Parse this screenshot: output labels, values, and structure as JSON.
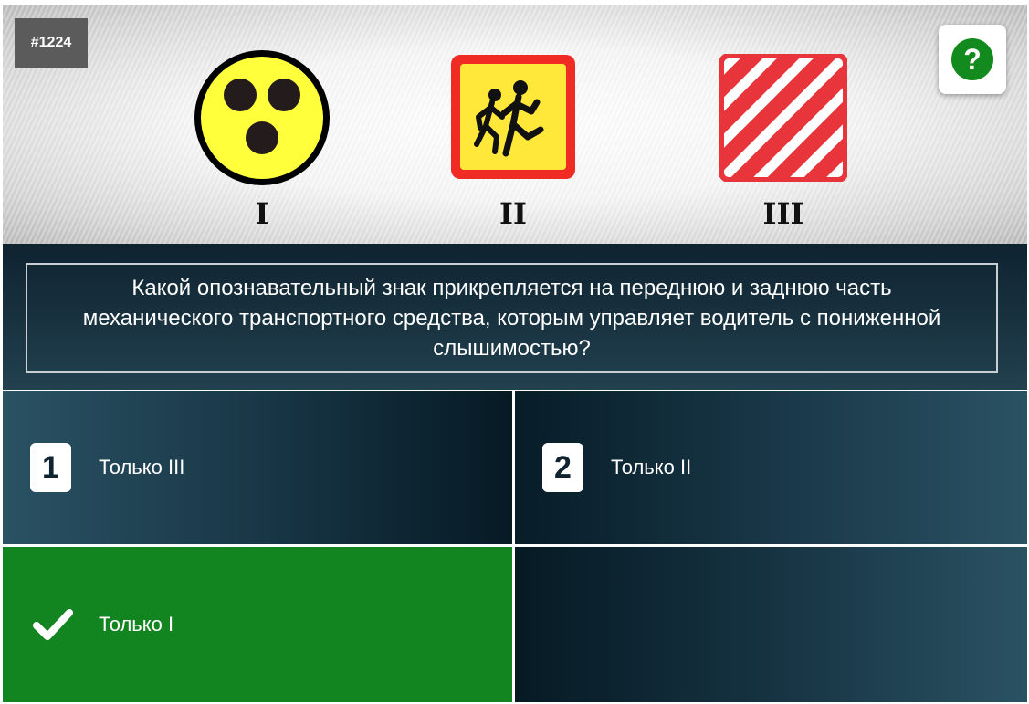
{
  "question": {
    "id": "#1224",
    "text": "Какой опознавательный знак прикрепляется на переднюю и заднюю часть механического транспортного средства, которым управляет водитель с пониженной слышимостью?"
  },
  "help": {
    "label": "?"
  },
  "signs": [
    {
      "label": "I",
      "icon": "deaf-driver-sign-icon"
    },
    {
      "label": "II",
      "icon": "children-transport-sign-icon"
    },
    {
      "label": "III",
      "icon": "oversized-cargo-sign-icon"
    }
  ],
  "answers": [
    {
      "number": "1",
      "text": "Только III"
    },
    {
      "number": "2",
      "text": "Только II"
    },
    {
      "number": "",
      "text": "Только I",
      "state": "correct",
      "icon": "checkmark-icon"
    },
    {
      "number": "",
      "text": ""
    }
  ],
  "colors": {
    "correct": "#138520",
    "dark_panel": "#173444",
    "help_green": "#138a1e"
  }
}
